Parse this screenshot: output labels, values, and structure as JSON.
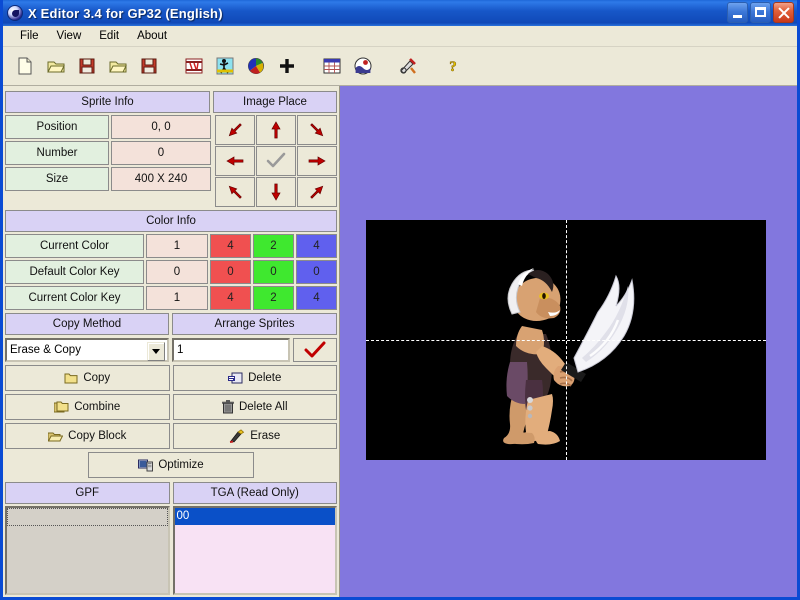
{
  "window": {
    "title": "X Editor 3.4 for GP32 (English)",
    "icon": "app-globe-icon",
    "buttons": {
      "minimize": "_",
      "maximize": "□",
      "close": "✕"
    },
    "titlebar_color": "#1757c8"
  },
  "menu": {
    "items": [
      "File",
      "View",
      "Edit",
      "About"
    ]
  },
  "toolbar": {
    "buttons": [
      {
        "name": "new-file-icon",
        "tip": "New"
      },
      {
        "name": "open-file-icon",
        "tip": "Open"
      },
      {
        "name": "save-file-icon",
        "tip": "Save"
      },
      {
        "name": "open-folder-icon",
        "tip": "Open"
      },
      {
        "name": "save-disk-icon",
        "tip": "Save"
      },
      {
        "name": "sprite-sheet-icon",
        "tip": "Sprite Sheet"
      },
      {
        "name": "animation-walk-icon",
        "tip": "Animate"
      },
      {
        "name": "palette-icon",
        "tip": "Palette"
      },
      {
        "name": "add-plus-icon",
        "tip": "Add"
      },
      {
        "name": "grid-table-icon",
        "tip": "Grid"
      },
      {
        "name": "image-preview-icon",
        "tip": "Preview"
      },
      {
        "name": "tools-icon",
        "tip": "Tools"
      },
      {
        "name": "help-question-icon",
        "tip": "Help"
      }
    ]
  },
  "sprite_info": {
    "header": "Sprite Info",
    "rows": [
      {
        "label": "Position",
        "value": "0, 0"
      },
      {
        "label": "Number",
        "value": "0"
      },
      {
        "label": "Size",
        "value": "400 X 240"
      }
    ]
  },
  "image_place": {
    "header": "Image Place",
    "buttons": [
      {
        "name": "move-up-left-arrow",
        "glyph": "↖"
      },
      {
        "name": "move-up-arrow",
        "glyph": "↑"
      },
      {
        "name": "move-up-right-arrow",
        "glyph": "↗"
      },
      {
        "name": "move-left-arrow",
        "glyph": "←"
      },
      {
        "name": "confirm-check",
        "glyph": "✓"
      },
      {
        "name": "move-right-arrow",
        "glyph": "→"
      },
      {
        "name": "move-down-left-arrow",
        "glyph": "↙"
      },
      {
        "name": "move-down-arrow",
        "glyph": "↓"
      },
      {
        "name": "move-down-right-arrow",
        "glyph": "↘"
      }
    ],
    "arrow_color": "#c00000",
    "check_color": "#9a9a9a"
  },
  "color_info": {
    "header": "Color Info",
    "rows": [
      {
        "label": "Current Color",
        "index": "1",
        "r": "4",
        "g": "2",
        "b": "4"
      },
      {
        "label": "Default Color Key",
        "index": "0",
        "r": "0",
        "g": "0",
        "b": "0"
      },
      {
        "label": "Current Color Key",
        "index": "1",
        "r": "4",
        "g": "2",
        "b": "4"
      }
    ],
    "swatch_colors": {
      "red": "#f05050",
      "green": "#3fe82f",
      "blue": "#6060ee"
    }
  },
  "copy_method": {
    "header": "Copy Method",
    "selected": "Erase & Copy"
  },
  "arrange_sprites": {
    "header": "Arrange Sprites",
    "value": "1",
    "apply_label": "✓"
  },
  "actions": [
    {
      "label": "Copy",
      "icon": "folder-icon",
      "name": "copy-button"
    },
    {
      "label": "Delete",
      "icon": "delete-icon",
      "name": "delete-button"
    },
    {
      "label": "Combine",
      "icon": "stack-folder-icon",
      "name": "combine-button"
    },
    {
      "label": "Delete All",
      "icon": "trash-icon",
      "name": "delete-all-button"
    },
    {
      "label": "Copy Block",
      "icon": "open-folder-icon",
      "name": "copy-block-button"
    },
    {
      "label": "Erase",
      "icon": "eraser-icon",
      "name": "erase-button"
    }
  ],
  "optimize": {
    "label": "Optimize",
    "icon": "monitor-icon"
  },
  "file_lists": {
    "gpf": {
      "header": "GPF",
      "items": []
    },
    "tga": {
      "header": "TGA (Read Only)",
      "items": [
        "00"
      ],
      "selected": "00"
    }
  },
  "canvas": {
    "background_color": "#8277de",
    "image_background": "#000000",
    "image_width": "400",
    "image_height": "240",
    "guide_color": "#ffffff",
    "sprite_description": "barbarian warrior holding curved scimitar"
  }
}
